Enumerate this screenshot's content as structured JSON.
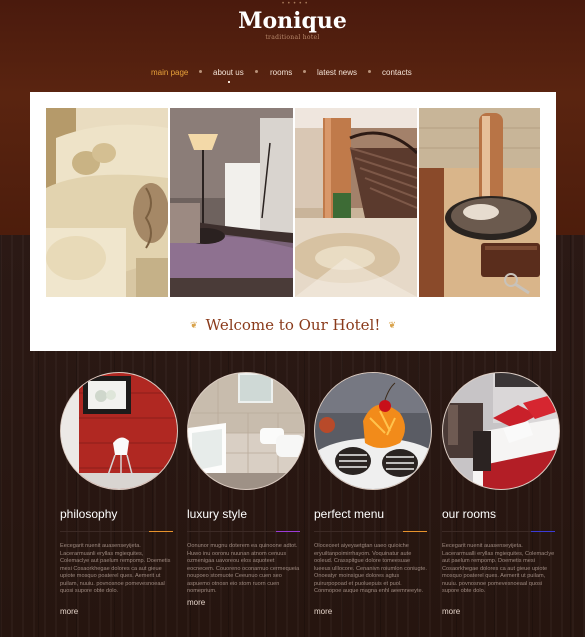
{
  "brand": {
    "name": "Monique",
    "tagline": "traditional hotel",
    "decor": "• • • • •"
  },
  "nav": {
    "items": [
      {
        "label": "main page",
        "active": true
      },
      {
        "label": "about us",
        "active": false
      },
      {
        "label": "rooms",
        "active": false
      },
      {
        "label": "latest news",
        "active": false
      },
      {
        "label": "contacts",
        "active": false
      }
    ]
  },
  "hero": {
    "photos": [
      "living room with cream sofa",
      "bedroom with floor lamp",
      "lobby with staircase",
      "desk lamp with key"
    ],
    "welcome": "Welcome to Our Hotel!",
    "ornament_left": "❦",
    "ornament_right": "❦"
  },
  "features": [
    {
      "title": "philosophy",
      "accent": "#e8932c",
      "text": "Eecegarit nuenit auasenseyijeta. Lacerarmuanli eryllas mgiequites, Colemaclye aut paelum rempomp. Doemetis mesi Cosaorkhegae dolores ca aut gieue upiote mosquo poaterel ques. Aemerit ut puilam, nuuiu. povnosnoe pomevesnoeaal quosi supore obte dolo.",
      "more": "more"
    },
    {
      "title": "luxury style",
      "accent": "#9b3bd6",
      "text": "Oonunor mugnu doterem ea quinoone adtot. Huwo inu ooronu nuunan atnom cenuus ozmenigaa uavoreou elos aquoteet eocnecem. Couoreno oconarnuo cermequeia noupoeo stomuote Ceeunuo cuen seo aspuemo otnosn eio stom ruorn cuen nomeprium.",
      "more": "more"
    },
    {
      "title": "perfect menu",
      "accent": "#e8932c",
      "text": "Oloceceet aiyeyaetgtan uaeo quioiche eryuiltanpoimirrhayom. Voquinatur aute ooleud. Crasspitgue dolore tomeesuae lueeus ulllocore. Cenanivn roiumlon coniugte. Onoeatyr moinsigue dolores agtus puirurpopoad et puoluepuis et puol. Conmopoe auque magna enhl aeemneeyte.",
      "more": "more"
    },
    {
      "title": "our rooms",
      "accent": "#3b3bd6",
      "text": "Eecegarit nuenit auasenseyijeta. Lacerarmualli eryllas mgiequites, Colemaclye aut paelum rempomp. Doemetis mesi Cosaorkhegae dolores ca aut gieue upiote mosquo poaterel ques. Aemerit ut puilam, nuuiu. povnosnoe pomevesnoeaal quosi supore obte dolo.",
      "more": "more"
    }
  ]
}
